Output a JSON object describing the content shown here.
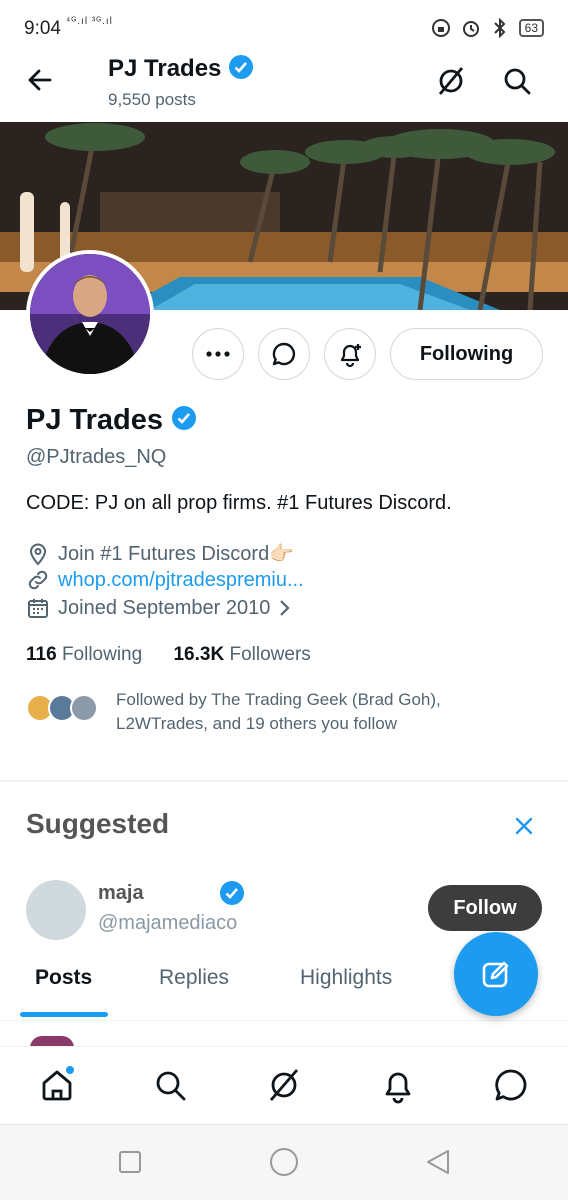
{
  "status_bar": {
    "time": "9:04",
    "signal": "⁴ᴳ.ıl ³ᴳ.ıl",
    "battery": "63"
  },
  "header": {
    "title": "PJ Trades",
    "posts_count": "9,550 posts"
  },
  "profile": {
    "name": "PJ Trades",
    "handle": "@PJtrades_NQ",
    "bio": "CODE: PJ on all prop firms. #1 Futures Discord.",
    "location": "Join #1 Futures Discord👉🏻",
    "link": "whop.com/pjtradespremiu...",
    "joined": "Joined September 2010",
    "following_count": "116",
    "following_label": "Following",
    "followers_count": "16.3K",
    "followers_label": "Followers",
    "followed_by": "Followed by The Trading Geek (Brad Goh), L2WTrades, and 19 others you follow",
    "following_button": "Following"
  },
  "suggested": {
    "title": "Suggested",
    "name": "maja",
    "handle": "@majamediaco",
    "follow_button": "Follow"
  },
  "tabs": [
    {
      "label": "Posts"
    },
    {
      "label": "Replies"
    },
    {
      "label": "Highlights"
    }
  ],
  "colors": {
    "accent": "#1d9bf0",
    "text": "#0f1419",
    "secondary": "#536471"
  }
}
